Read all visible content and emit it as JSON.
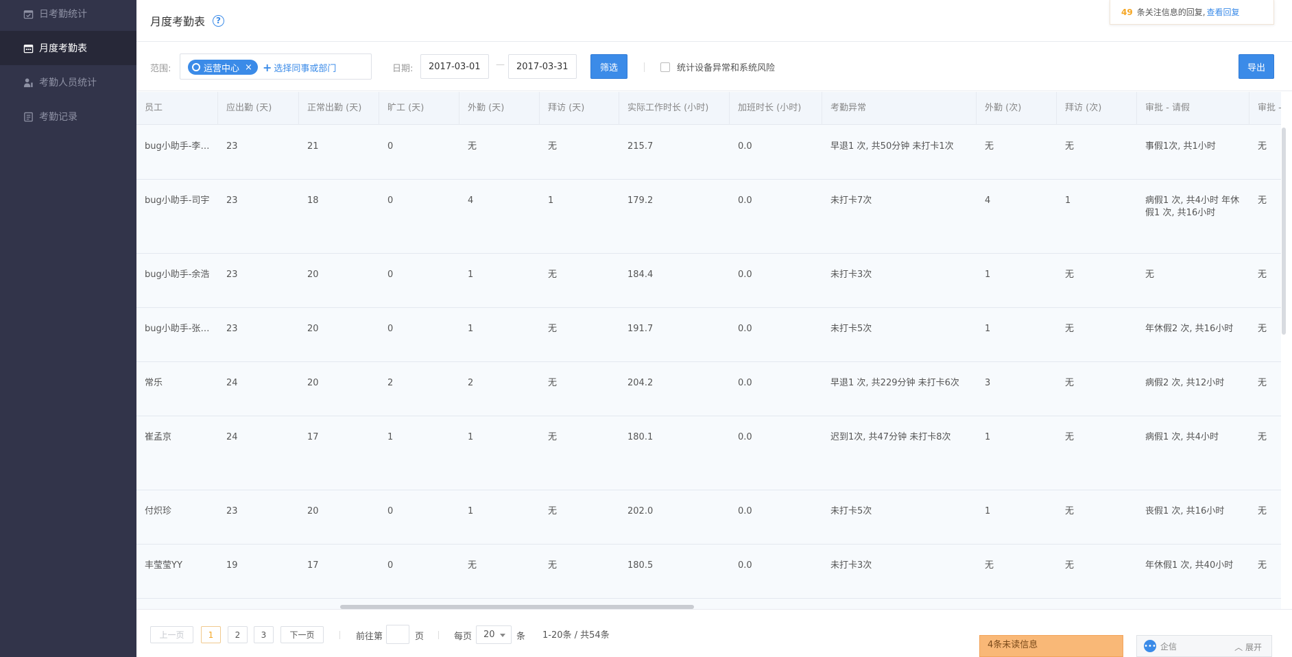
{
  "sidebar": {
    "items": [
      {
        "label": "日考勤统计",
        "icon": "calendar-check-icon",
        "active": false
      },
      {
        "label": "月度考勤表",
        "icon": "calendar-icon",
        "active": true
      },
      {
        "label": "考勤人员统计",
        "icon": "user-stats-icon",
        "active": false
      },
      {
        "label": "考勤记录",
        "icon": "record-list-icon",
        "active": false
      }
    ]
  },
  "header": {
    "title": "月度考勤表",
    "help_icon": "?"
  },
  "notice": {
    "count": "49",
    "text": "条关注信息的回复,",
    "link": "查看回复"
  },
  "filter": {
    "scope_label": "范围:",
    "scope_tag": "运营中心",
    "scope_tag_close": "×",
    "add_label": "选择同事或部门",
    "add_plus": "+",
    "date_label": "日期:",
    "date_start": "2017-03-01",
    "date_sep": "—",
    "date_end": "2017-03-31",
    "filter_button": "筛选",
    "checkbox_label": "统计设备异常和系统风险",
    "checkbox_checked": false,
    "export_button": "导出"
  },
  "table": {
    "columns": [
      "员工",
      "应出勤 (天)",
      "正常出勤 (天)",
      "旷工 (天)",
      "外勤 (天)",
      "拜访 (天)",
      "实际工作时长 (小时)",
      "加班时长 (小时)",
      "考勤异常",
      "外勤 (次)",
      "拜访 (次)",
      "审批 - 请假",
      "审批 - "
    ],
    "rows": [
      [
        "bug小助手-李强...",
        "23",
        "21",
        "0",
        "无",
        "无",
        "215.7",
        "0.0",
        "早退1 次, 共50分钟 未打卡1次",
        "无",
        "无",
        "事假1次, 共1小时",
        "无"
      ],
      [
        "bug小助手-司宇",
        "23",
        "18",
        "0",
        "4",
        "1",
        "179.2",
        "0.0",
        "未打卡7次",
        "4",
        "1",
        "病假1 次, 共4小时 年休假1 次, 共16小时",
        "无"
      ],
      [
        "bug小助手-余浩",
        "23",
        "20",
        "0",
        "1",
        "无",
        "184.4",
        "0.0",
        "未打卡3次",
        "1",
        "无",
        "无",
        "无"
      ],
      [
        "bug小助手-张智...",
        "23",
        "20",
        "0",
        "1",
        "无",
        "191.7",
        "0.0",
        "未打卡5次",
        "1",
        "无",
        "年休假2 次, 共16小时",
        "无"
      ],
      [
        "常乐",
        "24",
        "20",
        "2",
        "2",
        "无",
        "204.2",
        "0.0",
        "早退1 次, 共229分钟 未打卡6次",
        "3",
        "无",
        "病假2 次, 共12小时",
        "无"
      ],
      [
        "崔孟京",
        "24",
        "17",
        "1",
        "1",
        "无",
        "180.1",
        "0.0",
        "迟到1次, 共47分钟 未打卡8次",
        "1",
        "无",
        "病假1 次, 共4小时",
        "无"
      ],
      [
        "付炽珍",
        "23",
        "20",
        "0",
        "1",
        "无",
        "202.0",
        "0.0",
        "未打卡5次",
        "1",
        "无",
        "丧假1 次, 共16小时",
        "无"
      ],
      [
        "丰莹莹YY",
        "19",
        "17",
        "0",
        "无",
        "无",
        "180.5",
        "0.0",
        "未打卡3次",
        "无",
        "无",
        "年休假1 次, 共40小时",
        "无"
      ]
    ]
  },
  "pagination": {
    "prev": "上一页",
    "pages": [
      "1",
      "2",
      "3"
    ],
    "current_page": "1",
    "next": "下一页",
    "goto_prefix": "前往第",
    "goto_suffix": "页",
    "per_page_prefix": "每页",
    "per_page_value": "20",
    "per_page_suffix": "条",
    "summary": "1-20条 / 共54条"
  },
  "widgets": {
    "unread": "4条未读信息",
    "chat_label": "企信",
    "chat_expand": "展开"
  },
  "colors": {
    "accent": "#3b8be8",
    "sidebar_bg": "#32344a",
    "sidebar_active": "#272838",
    "orange": "#f5a623",
    "unread_bg": "#f9b877"
  }
}
